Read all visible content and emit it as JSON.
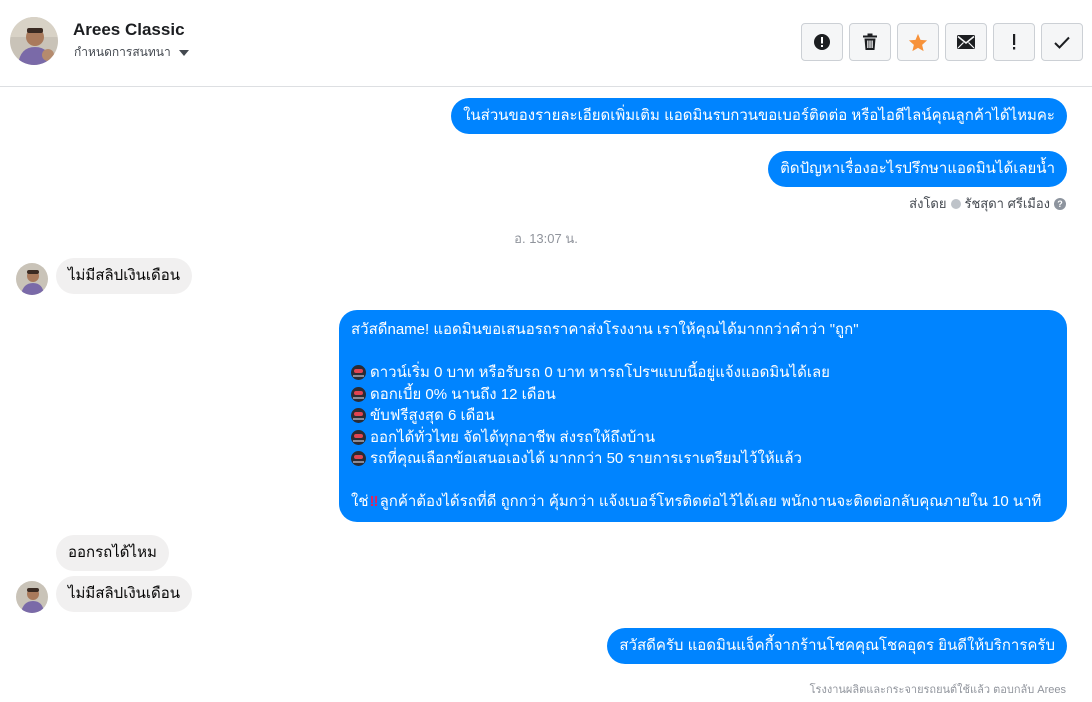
{
  "header": {
    "contact_name": "Arees Classic",
    "assign_label": "กำหนดการสนทนา",
    "toolbar": [
      {
        "name": "spam-button",
        "icon": "alert-circle-icon"
      },
      {
        "name": "delete-button",
        "icon": "trash-icon"
      },
      {
        "name": "star-button",
        "icon": "star-icon",
        "color": "#f7923a"
      },
      {
        "name": "mark-unread-button",
        "icon": "envelope-icon"
      },
      {
        "name": "follow-up-button",
        "icon": "exclamation-icon"
      },
      {
        "name": "mark-done-button",
        "icon": "check-icon"
      }
    ]
  },
  "messages": {
    "m1": "ในส่วนของรายละเอียดเพิ่มเติม แอดมินรบกวนขอเบอร์ติดต่อ หรือไอดีไลน์คุณลูกค้าได้ไหมคะ",
    "m2": "ติดปัญหาเรื่องอะไรปรึกษาแอดมินได้เลยน้ำ",
    "sent_by": "ส่งโดย",
    "sender": "รัชสุดา ศรีเมือง",
    "timestamp": "อ. 13:07 น.",
    "m3": "ไม่มีสลิปเงินเดือน",
    "promo": {
      "greeting": "สวัสดีname! แอดมินขอเสนอรถราคาส่งโรงงาน เราให้คุณได้มากกว่าคำว่า \"ถูก\"",
      "items": [
        "ดาวน์เริ่ม 0 บาท หรือรับรถ 0 บาท หารถโปรฯแบบนี้อยู่แจ้งแอดมินได้เลย",
        "ดอกเบี้ย 0% นานถึง 12 เดือน",
        "ขับฟรีสูงสุด 6 เดือน",
        "ออกได้ทั่วไทย จัดได้ทุกอาชีพ ส่งรถให้ถึงบ้าน",
        "รถที่คุณเลือกข้อเสนอเองได้ มากกว่า 50 รายการเราเตรียมไว้ให้แล้ว"
      ],
      "closing_prefix": "ใช่",
      "closing_mark": "‼",
      "closing": "ลูกค้าต้องได้รถที่ดี ถูกกว่า คุ้มกว่า แจ้งเบอร์โทรติดต่อไว้ได้เลย พนักงานจะติดต่อกลับคุณภายใน 10 นาที"
    },
    "m4": "ออกรถได้ไหม",
    "m5": "ไม่มีสลิปเงินเดือน",
    "m6": "สวัสดีครับ แอดมินแจ็คกี้จากร้านโชคคุณโชคอุดร ยินดีให้บริการครับ",
    "footer": "โรงงานผลิตและกระจายรถยนต์ใช้แล้ว ตอบกลับ Arees"
  }
}
